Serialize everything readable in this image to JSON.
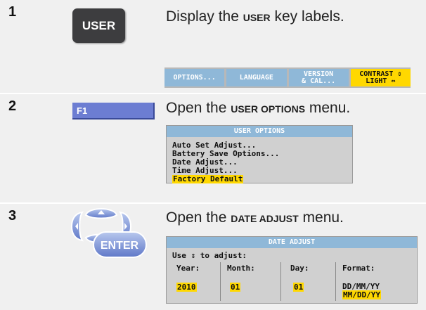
{
  "steps": [
    {
      "number": "1",
      "key_label": "USER",
      "desc_pre": "Display the ",
      "desc_bold": "USER",
      "desc_post": " key labels."
    },
    {
      "number": "2",
      "key_label": "F1",
      "desc_pre": "Open the ",
      "desc_bold": "USER OPTIONS",
      "desc_post": " menu."
    },
    {
      "number": "3",
      "key_label": "ENTER",
      "desc_pre": "Open the ",
      "desc_bold": "DATE ADJUST",
      "desc_post": " menu."
    }
  ],
  "softkeys": [
    {
      "label": "OPTIONS...",
      "active": false
    },
    {
      "label": "LANGUAGE",
      "active": false
    },
    {
      "label": "VERSION\n& CAL...",
      "active": false
    },
    {
      "label": "CONTRAST ⇕\nLIGHT ⇔",
      "active": true
    }
  ],
  "user_options": {
    "title": "USER OPTIONS",
    "items": [
      "Auto Set Adjust...",
      "Battery Save Options...",
      "Date Adjust...",
      "Time Adjust...",
      "Factory Default"
    ],
    "selected_index": 4
  },
  "date_adjust": {
    "title": "DATE ADJUST",
    "hint": "Use ⇕ to adjust:",
    "year_label": "Year:",
    "month_label": "Month:",
    "day_label": "Day:",
    "format_label": "Format:",
    "year_value": "2010",
    "month_value": "01",
    "day_value": "01",
    "format_option_1": "DD/MM/YY",
    "format_option_2": "MM/DD/YY",
    "format_selected": "MM/DD/YY"
  },
  "colors": {
    "softkey": "#8fb8d8",
    "highlight": "#ffd800",
    "user_key": "#3d3d3f",
    "f1_key": "#6c7dd2",
    "nav_blue": "#8aa0d8",
    "panel": "#f0f0f0"
  }
}
